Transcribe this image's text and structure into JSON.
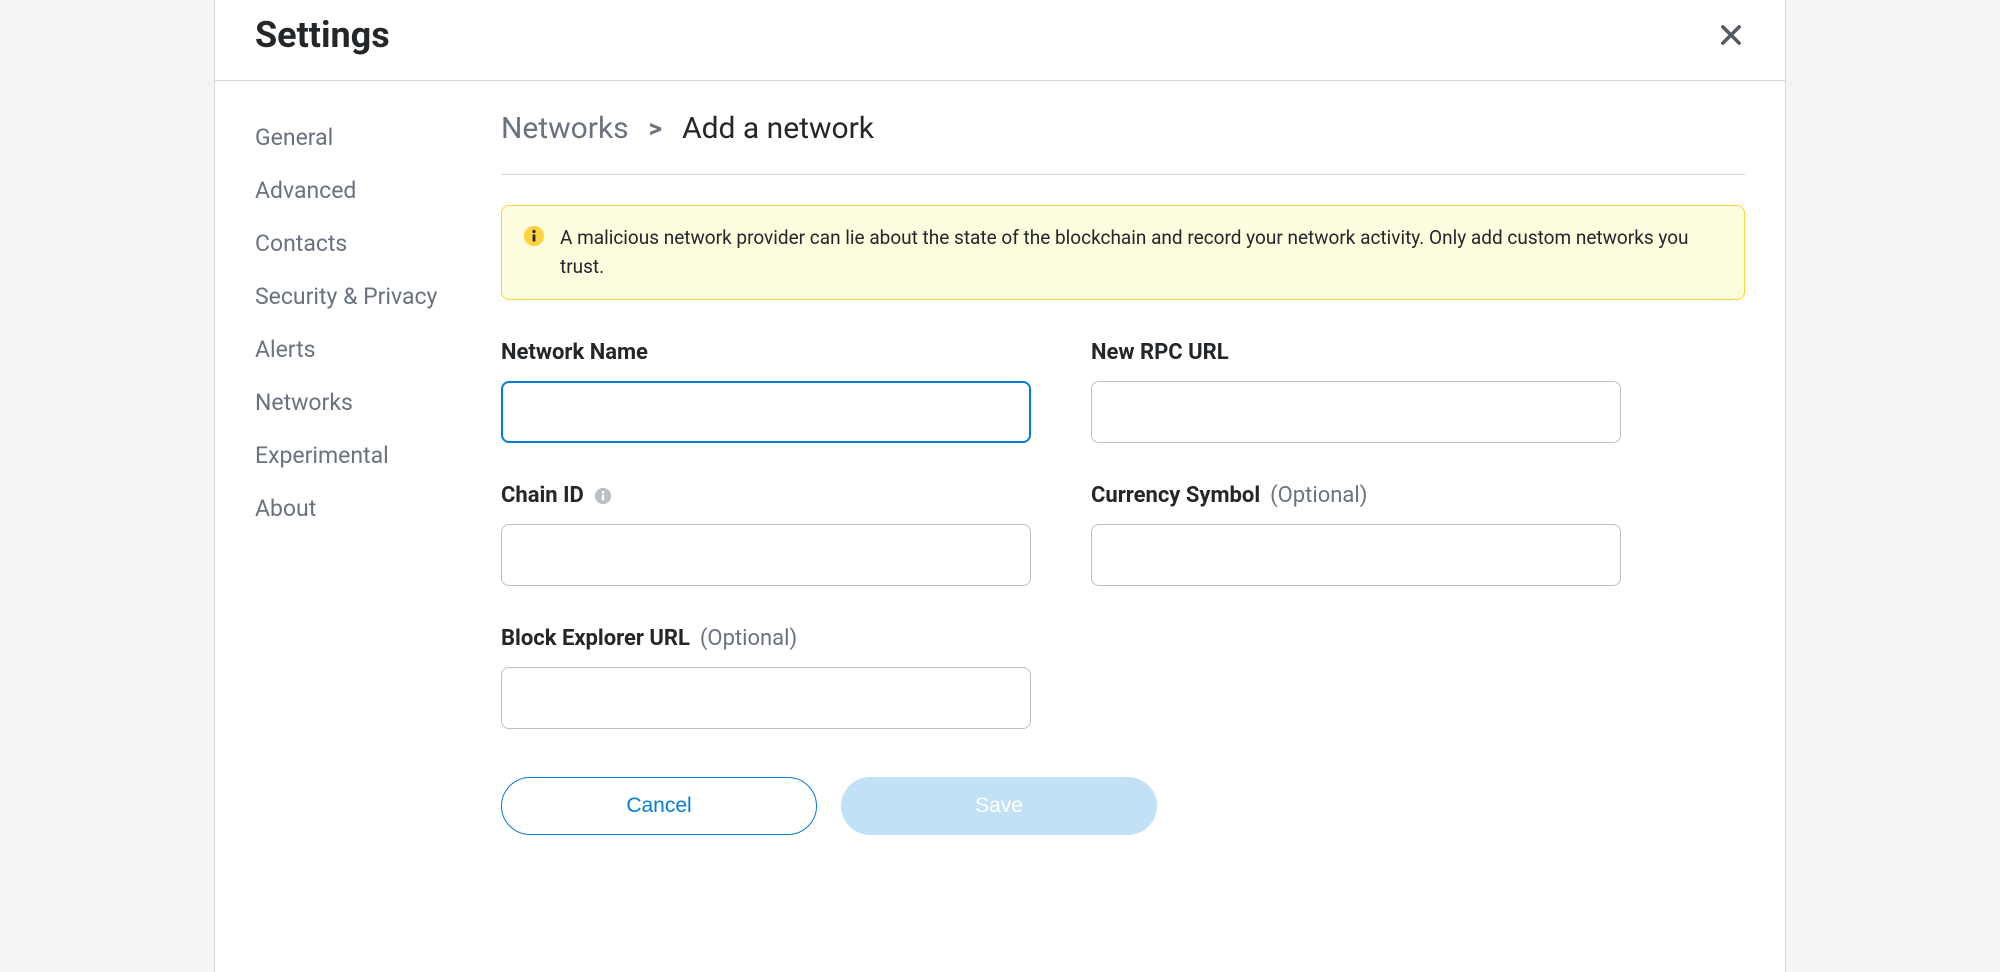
{
  "modal": {
    "title": "Settings"
  },
  "sidebar": {
    "items": [
      {
        "label": "General"
      },
      {
        "label": "Advanced"
      },
      {
        "label": "Contacts"
      },
      {
        "label": "Security & Privacy"
      },
      {
        "label": "Alerts"
      },
      {
        "label": "Networks"
      },
      {
        "label": "Experimental"
      },
      {
        "label": "About"
      }
    ]
  },
  "breadcrumb": {
    "back": "Networks",
    "separator": ">",
    "current": "Add a network"
  },
  "warning": {
    "text": "A malicious network provider can lie about the state of the blockchain and record your network activity. Only add custom networks you trust."
  },
  "form": {
    "network_name": {
      "label": "Network Name",
      "value": ""
    },
    "rpc_url": {
      "label": "New RPC URL",
      "value": ""
    },
    "chain_id": {
      "label": "Chain ID",
      "value": ""
    },
    "currency_symbol": {
      "label": "Currency Symbol",
      "optional": "(Optional)",
      "value": ""
    },
    "block_explorer": {
      "label": "Block Explorer URL",
      "optional": "(Optional)",
      "value": ""
    }
  },
  "buttons": {
    "cancel": "Cancel",
    "save": "Save"
  }
}
